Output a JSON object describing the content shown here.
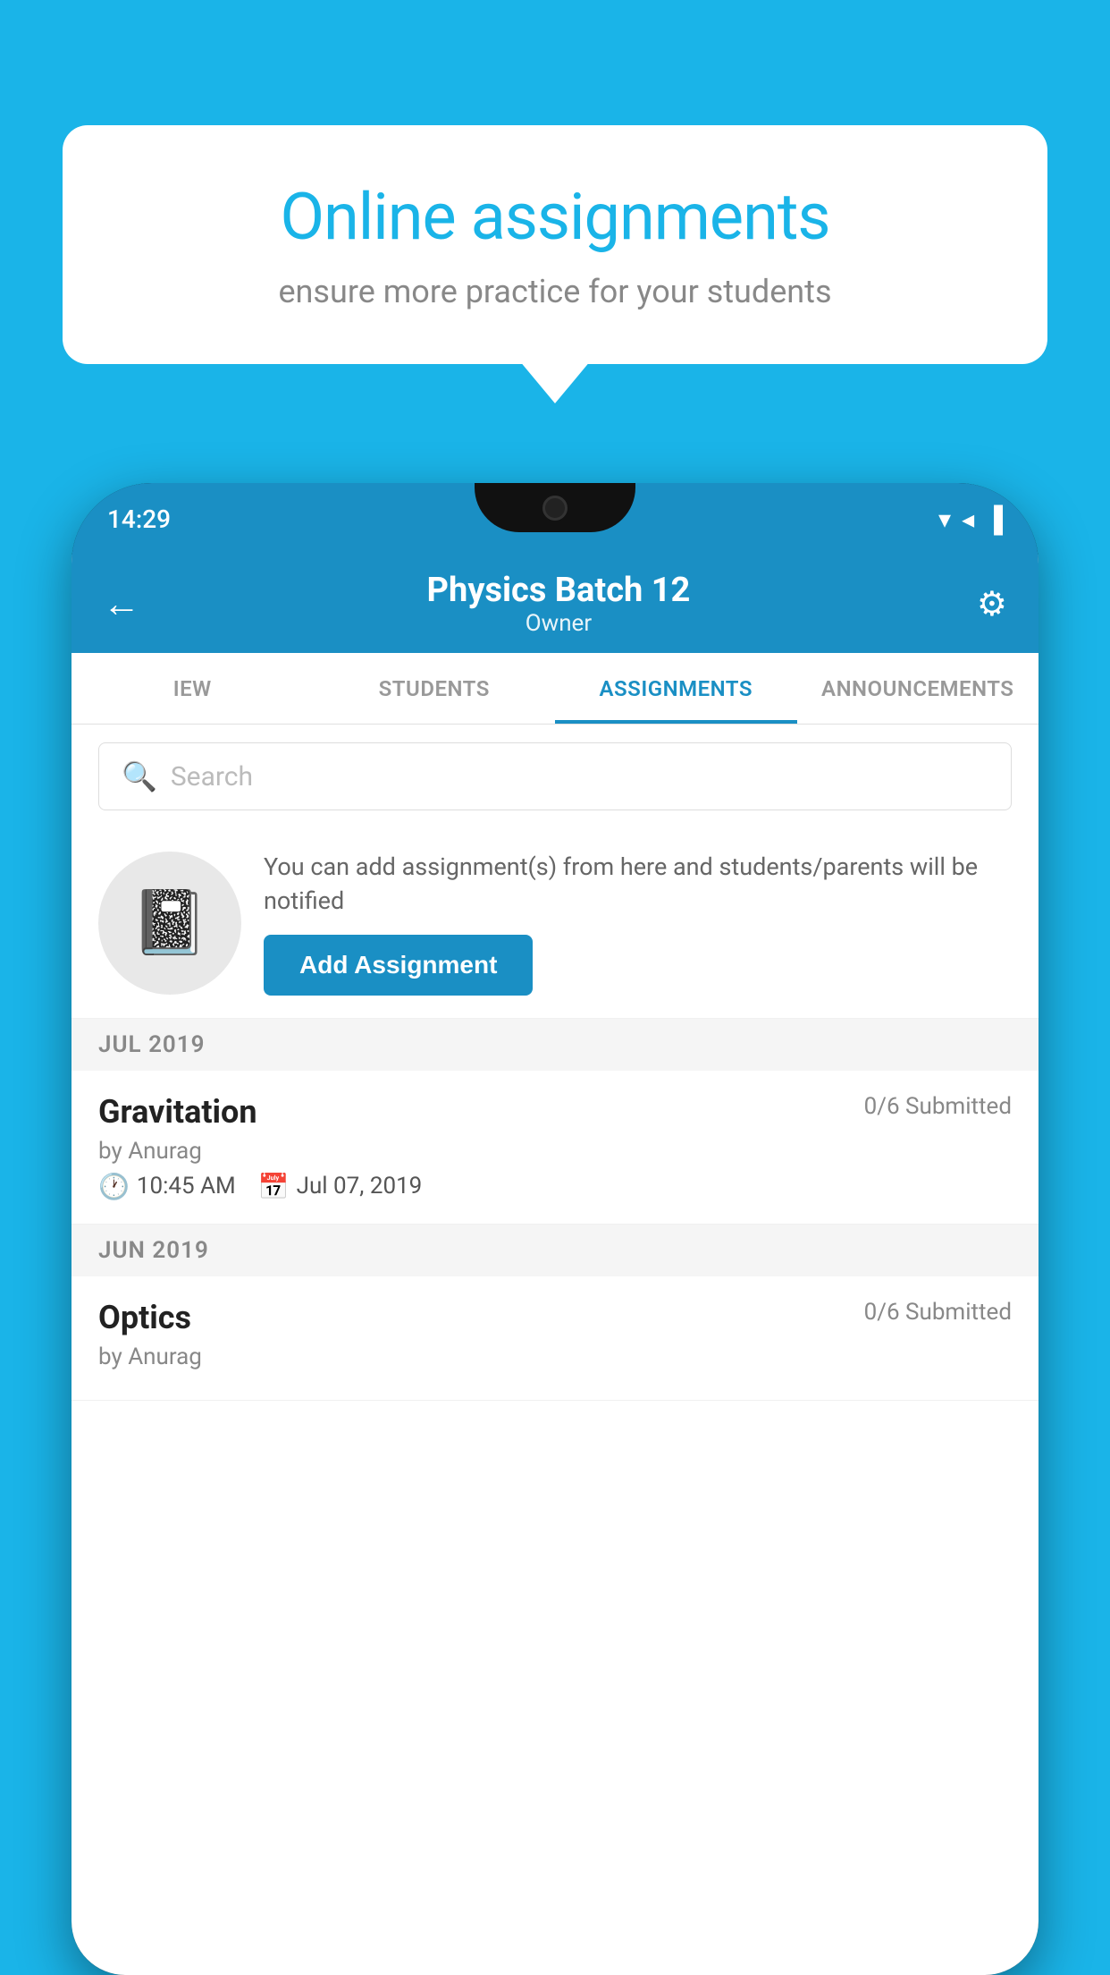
{
  "background_color": "#1ab4e8",
  "speech_bubble": {
    "title": "Online assignments",
    "subtitle": "ensure more practice for your students"
  },
  "phone": {
    "status_bar": {
      "time": "14:29",
      "wifi": "▼",
      "signal": "◀",
      "battery": "▐"
    },
    "header": {
      "title": "Physics Batch 12",
      "subtitle": "Owner",
      "back_label": "←",
      "settings_label": "⚙"
    },
    "tabs": [
      {
        "label": "IEW",
        "active": false
      },
      {
        "label": "STUDENTS",
        "active": false
      },
      {
        "label": "ASSIGNMENTS",
        "active": true
      },
      {
        "label": "ANNOUNCEMENTS",
        "active": false
      }
    ],
    "search": {
      "placeholder": "Search"
    },
    "info_card": {
      "description": "You can add assignment(s) from here and students/parents will be notified",
      "button_label": "Add Assignment"
    },
    "month_sections": [
      {
        "label": "JUL 2019",
        "assignments": [
          {
            "name": "Gravitation",
            "submitted": "0/6 Submitted",
            "author": "by Anurag",
            "time": "10:45 AM",
            "date": "Jul 07, 2019"
          }
        ]
      },
      {
        "label": "JUN 2019",
        "assignments": [
          {
            "name": "Optics",
            "submitted": "0/6 Submitted",
            "author": "by Anurag",
            "time": "",
            "date": ""
          }
        ]
      }
    ]
  }
}
